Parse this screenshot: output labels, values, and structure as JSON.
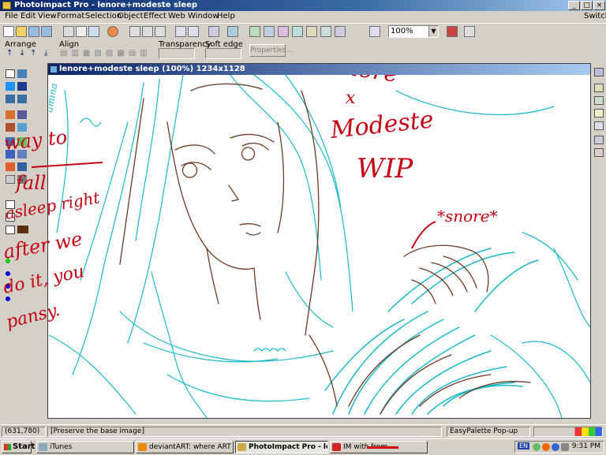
{
  "app": {
    "title": "PhotoImpact Pro - lenore+modeste sleep",
    "switch_label": "Switch"
  },
  "menu": [
    "File",
    "Edit",
    "View",
    "Format",
    "Selection",
    "Object",
    "Effect",
    "Web",
    "Window",
    "Help"
  ],
  "toolbar": {
    "zoom": "100%"
  },
  "attributes": {
    "arrange_label": "Arrange",
    "align_label": "Align",
    "transparency_label": "Transparency",
    "soft_edge_label": "Soft edge",
    "properties_label": "Properties..."
  },
  "document": {
    "title": "lenore+modeste sleep (100%) 1234x1128"
  },
  "canvas": {
    "handwriting": {
      "lenore": "Lenore",
      "x": "x",
      "modeste": "Modeste",
      "wip": "WIP",
      "snore": "*snore*",
      "left_note": [
        "way to",
        "fall",
        "asleep right",
        "after we",
        "do it, you",
        "pansy."
      ],
      "faint_text": "amina"
    },
    "colors": {
      "ink_red": "#c40012",
      "line_cyan": "#19b8c8",
      "line_brown": "#6b3a24"
    }
  },
  "status": {
    "coords": "(631,780)",
    "hint": "[Preserve the base image]",
    "palette": "EasyPalette Pop-up"
  },
  "taskbar": {
    "start": "Start",
    "buttons": [
      "iTunes",
      "deviantART: where ART ...",
      "PhotoImpact Pro - le...",
      "IM with              from ..."
    ],
    "lang": "EN",
    "time": "9:31 PM"
  }
}
